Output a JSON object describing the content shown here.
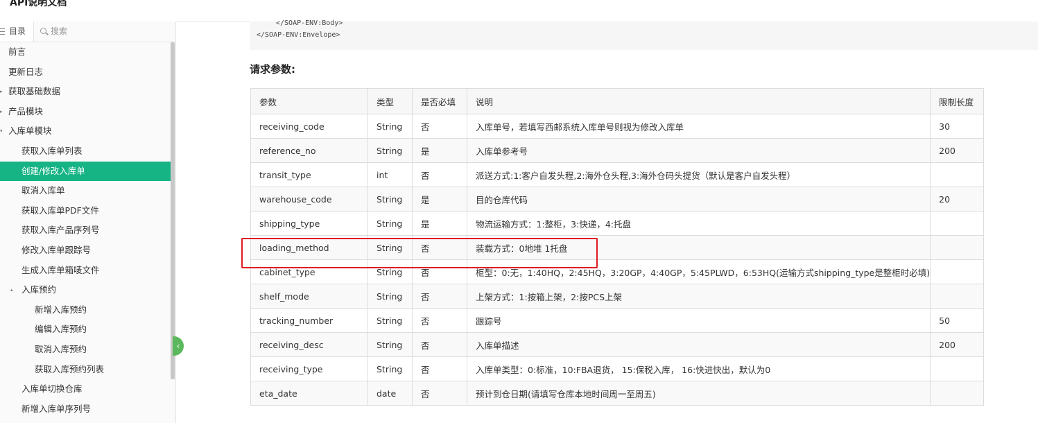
{
  "header": {
    "title": "API说明文档"
  },
  "sidebar": {
    "tab_toc": "目录",
    "search_placeholder": "搜索",
    "items": [
      {
        "label": "前言"
      },
      {
        "label": "更新日志"
      },
      {
        "label": "获取基础数据"
      },
      {
        "label": "产品模块"
      },
      {
        "label": "入库单模块"
      },
      {
        "label": "获取入库单列表"
      },
      {
        "label": "创建/修改入库单"
      },
      {
        "label": "取消入库单"
      },
      {
        "label": "获取入库单PDF文件"
      },
      {
        "label": "获取入库产品序列号"
      },
      {
        "label": "修改入库单跟踪号"
      },
      {
        "label": "生成入库单箱唛文件"
      },
      {
        "label": "入库预约"
      },
      {
        "label": "新增入库预约"
      },
      {
        "label": "编辑入库预约"
      },
      {
        "label": "取消入库预约"
      },
      {
        "label": "获取入库预约列表"
      },
      {
        "label": "入库单切换仓库"
      },
      {
        "label": "新增入库单序列号"
      }
    ]
  },
  "code": {
    "line1": "</SOAP-ENV:Body>",
    "line2": "</SOAP-ENV:Envelope>"
  },
  "section_title": "请求参数:",
  "table": {
    "headers": [
      "参数",
      "类型",
      "是否必填",
      "说明",
      "限制长度"
    ],
    "rows": [
      [
        "receiving_code",
        "String",
        "否",
        "入库单号，若填写西邮系统入库单号则视为修改入库单",
        "30"
      ],
      [
        "reference_no",
        "String",
        "是",
        "入库单参考号",
        "200"
      ],
      [
        "transit_type",
        "int",
        "否",
        "派送方式:1:客户自发头程,2:海外仓头程,3:海外仓码头提货（默认是客户自发头程）",
        ""
      ],
      [
        "warehouse_code",
        "String",
        "是",
        "目的仓库代码",
        "20"
      ],
      [
        "shipping_type",
        "String",
        "是",
        "物流运输方式：1:整柜，3:快递，4:托盘",
        ""
      ],
      [
        "loading_method",
        "String",
        "否",
        "装载方式：0地堆 1托盘",
        ""
      ],
      [
        "cabinet_type",
        "String",
        "否",
        "柜型：0:无，1:40HQ，2:45HQ，3:20GP，4:40GP，5:45PLWD，6:53HQ(运输方式shipping_type是整柜时必填)",
        ""
      ],
      [
        "shelf_mode",
        "String",
        "否",
        "上架方式：1:按箱上架，2:按PCS上架",
        ""
      ],
      [
        "tracking_number",
        "String",
        "否",
        "跟踪号",
        "50"
      ],
      [
        "receiving_desc",
        "String",
        "否",
        "入库单描述",
        "200"
      ],
      [
        "receiving_type",
        "String",
        "否",
        "入库单类型：0:标准，10:FBA退货， 15:保税入库， 16:快进快出，默认为0",
        ""
      ],
      [
        "eta_date",
        "date",
        "否",
        "预计到仓日期(请填写仓库本地时间周一至周五)",
        ""
      ]
    ]
  }
}
